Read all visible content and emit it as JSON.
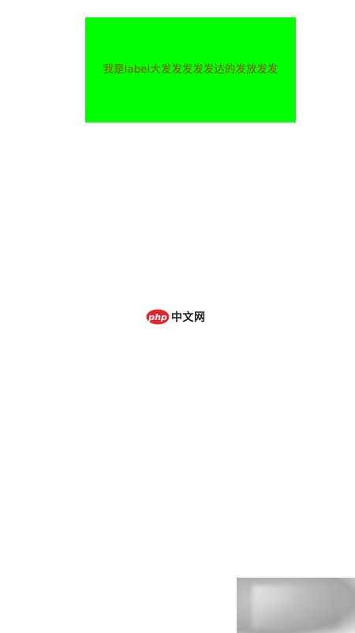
{
  "label": {
    "text": "我是label大发发发发发达的发放发发",
    "background_color": "#00ff00",
    "text_color": "#8a4e00"
  },
  "watermark": {
    "badge_text": "php",
    "text": "中文网",
    "badge_color": "#e3262d"
  }
}
